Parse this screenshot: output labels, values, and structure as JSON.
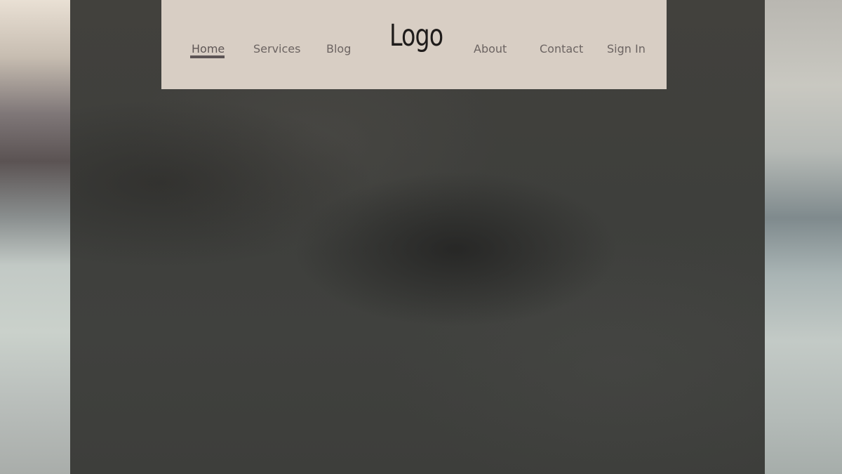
{
  "header": {
    "logo": "Logo",
    "nav": [
      {
        "label": "Home",
        "active": true
      },
      {
        "label": "Services",
        "active": false
      },
      {
        "label": "Blog",
        "active": false
      },
      {
        "label": "About",
        "active": false
      },
      {
        "label": "Contact",
        "active": false
      },
      {
        "label": "Sign In",
        "active": false
      }
    ]
  },
  "colors": {
    "nav_background": "#d8cec4",
    "nav_text": "#6c6462",
    "logo_text": "#1f1c1b",
    "hero_background": "#3f403d",
    "active_underline": "#5c5455"
  }
}
